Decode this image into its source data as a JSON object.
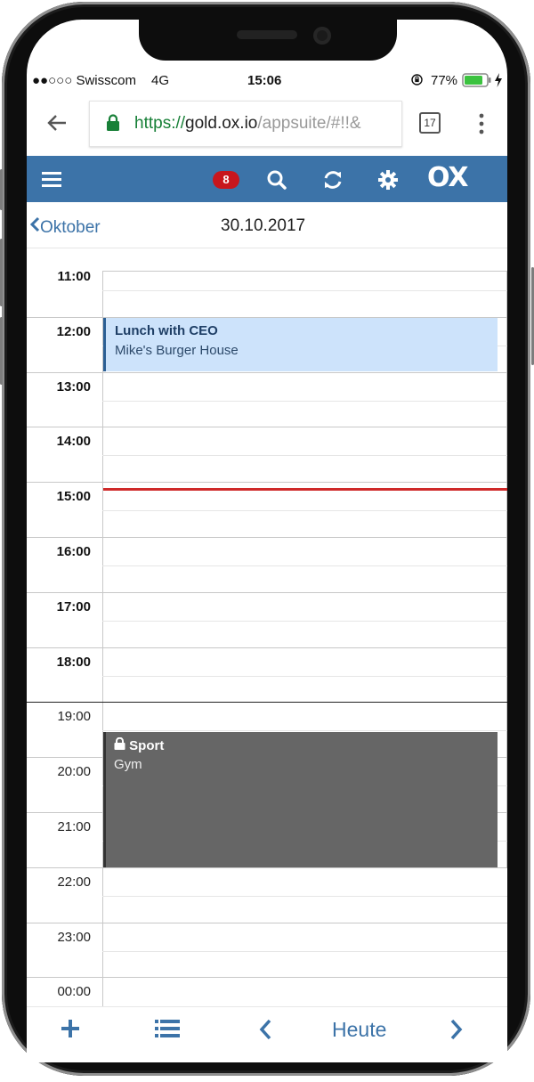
{
  "status_bar": {
    "carrier": "●●○○○ Swisscom",
    "network": "4G",
    "time": "15:06",
    "battery": "77%",
    "icons": [
      "rotation-lock-icon",
      "battery-icon",
      "charging-icon"
    ]
  },
  "browser": {
    "url_protocol": "https://",
    "url_host": "gold.ox.io",
    "url_path": "/appsuite/#!!&",
    "tab_count": "17",
    "icons": [
      "back-arrow-icon",
      "lock-icon",
      "tabs-icon",
      "menu-dots-icon"
    ]
  },
  "app_header": {
    "notification_count": "8",
    "logo": "OX",
    "icons": [
      "hamburger-menu-icon",
      "search-icon",
      "refresh-icon",
      "gear-icon"
    ],
    "colors": {
      "bar": "#3c73a8",
      "badge": "#c8161d"
    }
  },
  "nav": {
    "back_label": "Oktober",
    "date_title": "30.10.2017"
  },
  "calendar": {
    "hours": [
      "11:00",
      "12:00",
      "13:00",
      "14:00",
      "15:00",
      "16:00",
      "17:00",
      "18:00",
      "19:00",
      "20:00",
      "21:00",
      "22:00",
      "23:00",
      "00:00"
    ],
    "current_time_line": "15:06",
    "appointments": [
      {
        "title": "Lunch with CEO",
        "location": "Mike's Burger House",
        "start": "12:00",
        "end": "13:00",
        "private": false,
        "color": "#cde3fb"
      },
      {
        "title": "Sport",
        "location": "Gym",
        "start": "19:30",
        "end": "22:00",
        "private": true,
        "color": "#666666"
      }
    ]
  },
  "toolbar": {
    "today_label": "Heute",
    "icons": [
      "add-icon",
      "list-icon",
      "previous-icon",
      "next-icon"
    ]
  }
}
